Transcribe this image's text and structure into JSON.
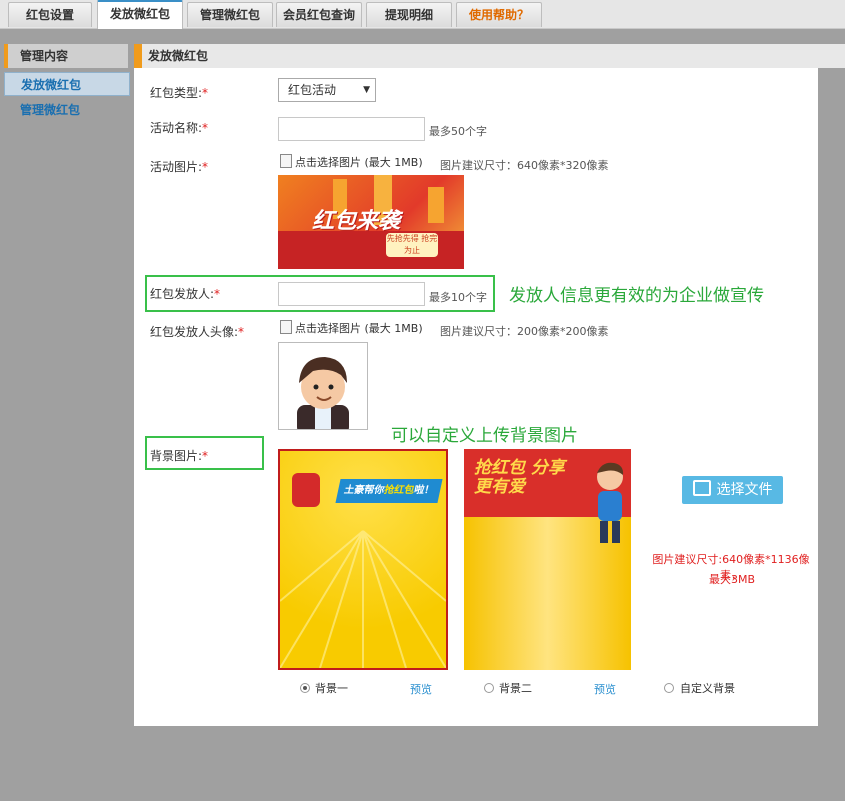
{
  "tabs": [
    {
      "label": "红包设置"
    },
    {
      "label": "发放微红包"
    },
    {
      "label": "管理微红包"
    },
    {
      "label": "会员红包查询"
    },
    {
      "label": "提现明细"
    },
    {
      "label": "使用帮助？"
    }
  ],
  "sidebar": {
    "header": "管理内容",
    "items": [
      {
        "label": "发放微红包"
      },
      {
        "label": "管理微红包"
      }
    ]
  },
  "panel": {
    "title": "发放微红包"
  },
  "form": {
    "type_label": "红包类型:",
    "type_value": "红包活动",
    "name_label": "活动名称:",
    "name_hint": "最多50个字",
    "image_label": "活动图片:",
    "upload_text": "点击选择图片 (最大 1MB)",
    "image_size_hint": "图片建议尺寸：640像素*320像素",
    "sender_label": "红包发放人:",
    "sender_hint": "最多10个字",
    "avatar_label": "红包发放人头像:",
    "avatar_upload_text": "点击选择图片 (最大 1MB)",
    "avatar_size_hint": "图片建议尺寸：200像素*200像素",
    "background_label": "背景图片:",
    "required_mark": "*"
  },
  "images": {
    "activity_text": "红包来袭",
    "activity_badge": "先抢先得 抢完为止",
    "bg1_banner_pre": "土豪帮你",
    "bg1_banner_hl": "抢红包",
    "bg1_banner_post": "啦！",
    "bg2_title": "抢红包 分享更有爱"
  },
  "annotations": {
    "sender_note": "发放人信息更有效的为企业做宣传",
    "background_note": "可以自定义上传背景图片"
  },
  "background": {
    "choose_button": "选择文件",
    "size_hint_line1": "图片建议尺寸:640像素*1136像素，",
    "size_hint_line2": "最大3MB",
    "options": [
      {
        "label": "背景一",
        "selected": true
      },
      {
        "label": "背景二",
        "selected": false
      },
      {
        "label": "自定义背景",
        "selected": false
      }
    ],
    "preview_label": "预览"
  }
}
